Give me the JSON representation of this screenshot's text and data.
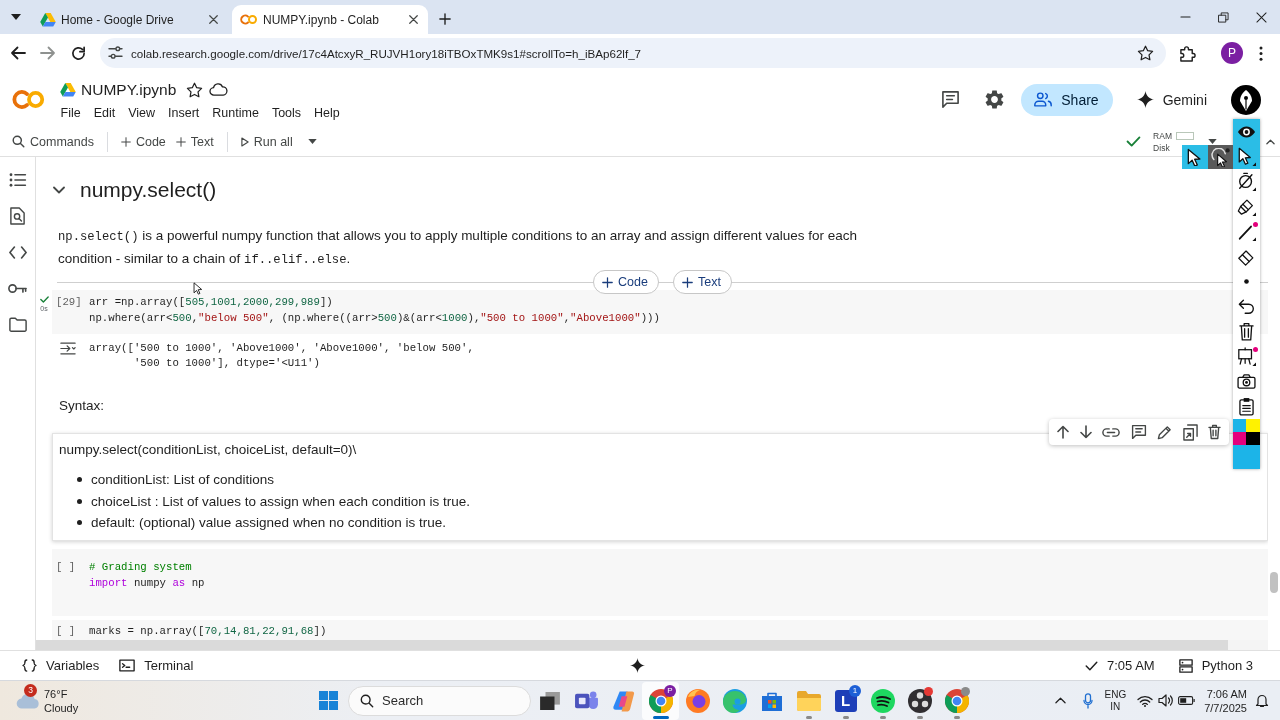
{
  "browser": {
    "tabs": [
      {
        "kind": "drive",
        "title": "Home - Google Drive",
        "selected": false
      },
      {
        "kind": "colab",
        "title": "NUMPY.ipynb - Colab",
        "selected": true
      }
    ],
    "address": {
      "url": "colab.research.google.com/drive/17c4AtcxyR_RUJVH1ory18iTBOxTMK9s1#scrollTo=h_iBAp62lf_7",
      "bookmarked": false
    },
    "profile_initial": "P"
  },
  "notebook": {
    "title": "NUMPY.ipynb",
    "starred": false,
    "menu": [
      "File",
      "Edit",
      "View",
      "Insert",
      "Runtime",
      "Tools",
      "Help"
    ],
    "share": "Share",
    "gemini": "Gemini"
  },
  "toolbar": {
    "commands": "Commands",
    "add_code": "Code",
    "add_text": "Text",
    "run_all": "Run all",
    "connected": true,
    "ram": "RAM",
    "disk": "Disk"
  },
  "section": {
    "title": "numpy.select()",
    "expanded": true
  },
  "intro": [
    {
      "kind": "code",
      "text": "np.select()"
    },
    {
      "kind": "text",
      "text": " is a powerful numpy function that allows you to apply multiple conditions to an array and assign different values for each condition - similar to a chain of "
    },
    {
      "kind": "code",
      "text": "if..elif..else"
    },
    {
      "kind": "text",
      "text": "."
    }
  ],
  "insert_buttons": [
    "Code",
    "Text"
  ],
  "cells": [
    {
      "kind": "code",
      "prompt": "[29]",
      "executed": true,
      "duration": "0s",
      "lines": [
        [
          {
            "kind": "plain",
            "text": "arr =np.array(["
          },
          {
            "kind": "number",
            "text": "505,1001,2000,299,989"
          },
          {
            "kind": "plain",
            "text": "])"
          }
        ],
        [
          {
            "kind": "plain",
            "text": "np.where(arr<"
          },
          {
            "kind": "number",
            "text": "500"
          },
          {
            "kind": "plain",
            "text": ","
          },
          {
            "kind": "string",
            "text": "\"below 500\""
          },
          {
            "kind": "plain",
            "text": ", (np.where((arr>"
          },
          {
            "kind": "number",
            "text": "500"
          },
          {
            "kind": "plain",
            "text": ")&(arr<"
          },
          {
            "kind": "number",
            "text": "1000"
          },
          {
            "kind": "plain",
            "text": "),"
          },
          {
            "kind": "string",
            "text": "\"500 to 1000\""
          },
          {
            "kind": "plain",
            "text": ","
          },
          {
            "kind": "string",
            "text": "\"Above1000\""
          },
          {
            "kind": "plain",
            "text": ")))"
          }
        ]
      ],
      "output": {
        "lines": [
          "array(['500 to 1000', 'Above1000', 'Above1000', 'below 500',",
          "       '500 to 1000'], dtype='<U11')"
        ]
      }
    },
    {
      "kind": "text",
      "selected": false,
      "blocks": [
        {
          "kind": "paragraph",
          "text": "Syntax:"
        }
      ]
    },
    {
      "kind": "text",
      "selected": true,
      "blocks": [
        {
          "kind": "paragraph",
          "text": "numpy.select(conditionList, choiceList, default=0)\\"
        },
        {
          "kind": "bullets",
          "items": [
            "conditionList: List of conditions",
            "choiceList : List of values to assign when each condition is true.",
            "default: (optional) value assigned when no condition is true."
          ]
        }
      ]
    },
    {
      "kind": "code",
      "prompt": "[ ]",
      "executed": false,
      "lines": [
        [
          {
            "kind": "comment",
            "text": "# Grading system"
          }
        ],
        [
          {
            "kind": "keyword",
            "text": "import"
          },
          {
            "kind": "plain",
            "text": " numpy "
          },
          {
            "kind": "keyword",
            "text": "as"
          },
          {
            "kind": "plain",
            "text": " np"
          }
        ]
      ]
    },
    {
      "kind": "code",
      "prompt": "[ ]",
      "executed": false,
      "lines": [
        [
          {
            "kind": "plain",
            "text": "marks = np.array(["
          },
          {
            "kind": "number",
            "text": "70,14,81,22,91,68"
          },
          {
            "kind": "plain",
            "text": "])"
          }
        ]
      ]
    }
  ],
  "status_bar": {
    "variables": "Variables",
    "terminal": "Terminal",
    "last_run": "7:05 AM",
    "runtime": "Python 3"
  },
  "annotation_toolbar": {
    "tools": [
      {
        "kind": "eye",
        "selected": true,
        "color_dot": false
      },
      {
        "kind": "pointer",
        "selected": true,
        "color_dot": false
      },
      {
        "kind": "ring",
        "selected": false,
        "color_dot": false
      },
      {
        "kind": "highlighter",
        "selected": false,
        "color_dot": false
      },
      {
        "kind": "pen",
        "selected": false,
        "color_dot": true
      },
      {
        "kind": "eraser",
        "selected": false,
        "color_dot": false
      },
      {
        "kind": "dot",
        "selected": false,
        "color_dot": false
      },
      {
        "kind": "undo",
        "selected": false,
        "color_dot": false
      },
      {
        "kind": "trash",
        "selected": false,
        "color_dot": false
      },
      {
        "kind": "board",
        "selected": false,
        "color_dot": true
      },
      {
        "kind": "camera",
        "selected": false,
        "color_dot": false
      },
      {
        "kind": "clipboard",
        "selected": false,
        "color_dot": false
      }
    ],
    "pointer_options": [
      {
        "kind": "pointer",
        "selected": true
      },
      {
        "kind": "click",
        "selected": false
      }
    ],
    "swatches": [
      {
        "kind": "small",
        "color": "#1cb4e8"
      },
      {
        "kind": "small",
        "color": "#fff200"
      },
      {
        "kind": "small",
        "color": "#e4007c"
      },
      {
        "kind": "small",
        "color": "#000000"
      },
      {
        "kind": "large",
        "color": "#1cb4e8"
      }
    ]
  },
  "taskbar": {
    "weather": {
      "alerts": "3",
      "temperature": "76°F",
      "condition": "Cloudy"
    },
    "search_placeholder": "Search",
    "apps": [
      {
        "kind": "task-view",
        "running": false,
        "selected": false
      },
      {
        "kind": "chat",
        "running": false,
        "selected": false
      },
      {
        "kind": "assistant",
        "running": false,
        "selected": false
      },
      {
        "kind": "browser",
        "running": true,
        "selected": true,
        "badge": "P"
      },
      {
        "kind": "globe",
        "running": false,
        "selected": false
      },
      {
        "kind": "wave",
        "running": false,
        "selected": false
      },
      {
        "kind": "store",
        "running": false,
        "selected": false
      },
      {
        "kind": "folder",
        "running": true,
        "selected": false
      },
      {
        "kind": "letter",
        "label": "L",
        "badge": "1",
        "running": true,
        "selected": false
      },
      {
        "kind": "music",
        "running": true,
        "selected": false
      },
      {
        "kind": "record",
        "running": true,
        "selected": false,
        "color": "#e53935"
      },
      {
        "kind": "browser",
        "running": true,
        "selected": false,
        "color": "#8a8a8a"
      }
    ],
    "tray": {
      "language": "ENG",
      "region": "IN",
      "time": "7:06 AM",
      "date": "7/7/2025"
    }
  }
}
